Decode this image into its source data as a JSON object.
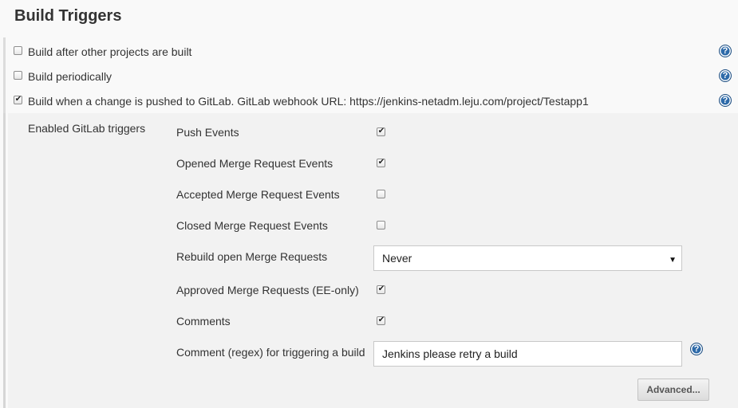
{
  "section": {
    "title": "Build Triggers"
  },
  "triggers": [
    {
      "label": "Build after other projects are built",
      "checked": false
    },
    {
      "label": "Build periodically",
      "checked": false
    },
    {
      "label": "Build when a change is pushed to GitLab. GitLab webhook URL: https://jenkins-netadm.leju.com/project/Testapp1",
      "checked": true
    }
  ],
  "gitlab": {
    "group_label": "Enabled GitLab triggers",
    "options": [
      {
        "label": "Push Events",
        "checked": true
      },
      {
        "label": "Opened Merge Request Events",
        "checked": true
      },
      {
        "label": "Accepted Merge Request Events",
        "checked": false
      },
      {
        "label": "Closed Merge Request Events",
        "checked": false
      },
      {
        "label": "Rebuild open Merge Requests",
        "control": "select",
        "value": "Never"
      },
      {
        "label": "Approved Merge Requests (EE-only)",
        "checked": true
      },
      {
        "label": "Comments",
        "checked": true
      },
      {
        "label": "Comment (regex) for triggering a build",
        "control": "text",
        "value": "Jenkins please retry a build"
      }
    ],
    "advanced_label": "Advanced..."
  },
  "icons": {
    "help": "question-help-icon",
    "check": "check-icon",
    "dropdown": "dropdown-arrow-icon"
  },
  "help_symbol": "?",
  "check_symbol": "✔",
  "colors": {
    "help_icon": "#2d6aa9",
    "nested_bg": "#f2f2f2",
    "page_bg": "#f9f9f9"
  }
}
